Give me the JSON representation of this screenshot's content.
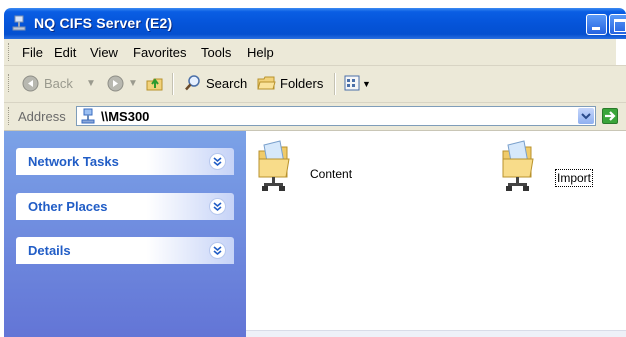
{
  "window": {
    "title": "NQ CIFS Server (E2)"
  },
  "menu": {
    "items": [
      "File",
      "Edit",
      "View",
      "Favorites",
      "Tools",
      "Help"
    ]
  },
  "toolbar": {
    "back_label": "Back",
    "search_label": "Search",
    "folders_label": "Folders"
  },
  "address": {
    "label": "Address",
    "value": "\\\\MS300"
  },
  "task_pane": {
    "sections": [
      {
        "title": "Network Tasks"
      },
      {
        "title": "Other Places"
      },
      {
        "title": "Details"
      }
    ]
  },
  "content": {
    "items": [
      {
        "label": "Content",
        "icon": "shared-folder-icon"
      },
      {
        "label": "Import",
        "icon": "shared-folder-icon"
      }
    ]
  },
  "colors": {
    "titlebar": "#0554d9",
    "taskpane_top": "#7ba2e7",
    "taskpane_bottom": "#6375d6",
    "task_title": "#215dc6"
  }
}
